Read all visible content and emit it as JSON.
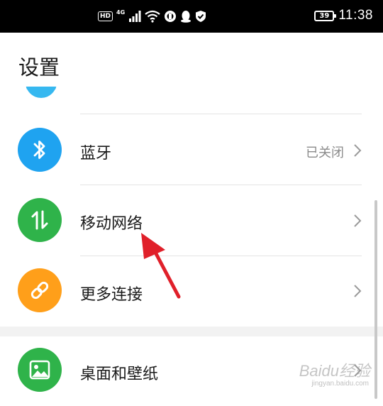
{
  "status_bar": {
    "hd_badge": "HD",
    "network_label": "4G",
    "battery": "39",
    "time": "11:38"
  },
  "page": {
    "title": "设置"
  },
  "settings": {
    "bluetooth": {
      "label": "蓝牙",
      "value": "已关闭",
      "icon": "bluetooth-icon",
      "color": "#1fa3f0"
    },
    "mobile_network": {
      "label": "移动网络",
      "icon": "data-arrows-icon",
      "color": "#2fb34a"
    },
    "more_connections": {
      "label": "更多连接",
      "icon": "link-icon",
      "color": "#ff9f1a"
    },
    "home_wallpaper": {
      "label": "桌面和壁纸",
      "icon": "picture-icon",
      "color": "#2fb34a"
    }
  },
  "colors": {
    "annotation_arrow": "#e0202a",
    "partial_top_icon": "#36b8f0"
  },
  "watermark": {
    "brand": "Baidu经验",
    "url": "jingyan.baidu.com"
  }
}
